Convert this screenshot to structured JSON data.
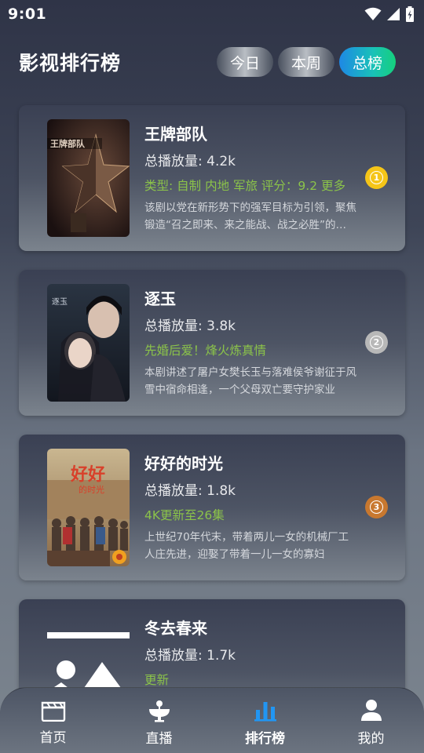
{
  "status_bar": {
    "time": "9:01"
  },
  "header": {
    "title": "影视排行榜"
  },
  "tabs": [
    {
      "label": "今日",
      "active": false
    },
    {
      "label": "本周",
      "active": false
    },
    {
      "label": "总榜",
      "active": true
    }
  ],
  "items": [
    {
      "title": "王牌部队",
      "plays": "总播放量: 4.2k",
      "tagline": "类型: 自制 内地 军旅 评分：9.2 更多",
      "desc": "该剧以党在新形势下的强军目标为引领，聚焦锻造“召之即来、来之能战、战之必胜”的王牌部队",
      "rank": "1",
      "rank_color": "#f5c518",
      "poster": "poster-wangpai"
    },
    {
      "title": "逐玉",
      "plays": "总播放量: 3.8k",
      "tagline": "先婚后爱！烽火炼真情",
      "desc": "本剧讲述了屠户女樊长玉与落难侯爷谢征于风雪中宿命相逢，一个父母双亡要守护家业",
      "rank": "2",
      "rank_color": "#b8b8b8",
      "poster": "poster-zhuyu"
    },
    {
      "title": "好好的时光",
      "plays": "总播放量: 1.8k",
      "tagline": "4K更新至26集",
      "desc": "上世纪70年代末，带着两儿一女的机械厂工人庄先进，迎娶了带着一儿一女的寡妇",
      "rank": "3",
      "rank_color": "#c8782f",
      "poster": "poster-haohao"
    },
    {
      "title": "冬去春来",
      "plays": "总播放量: 1.7k",
      "tagline": "更新",
      "desc": "",
      "rank": "",
      "rank_color": "",
      "poster": "image-placeholder-icon"
    }
  ],
  "nav": [
    {
      "label": "首页",
      "icon": "clapperboard-icon",
      "active": false
    },
    {
      "label": "直播",
      "icon": "live-podium-icon",
      "active": false
    },
    {
      "label": "排行榜",
      "icon": "bar-chart-icon",
      "active": true
    },
    {
      "label": "我的",
      "icon": "user-icon",
      "active": false
    }
  ],
  "colors": {
    "accent": "#1e88e5",
    "tagline": "#8bc34a",
    "active_nav_icon": "#2196f3"
  }
}
